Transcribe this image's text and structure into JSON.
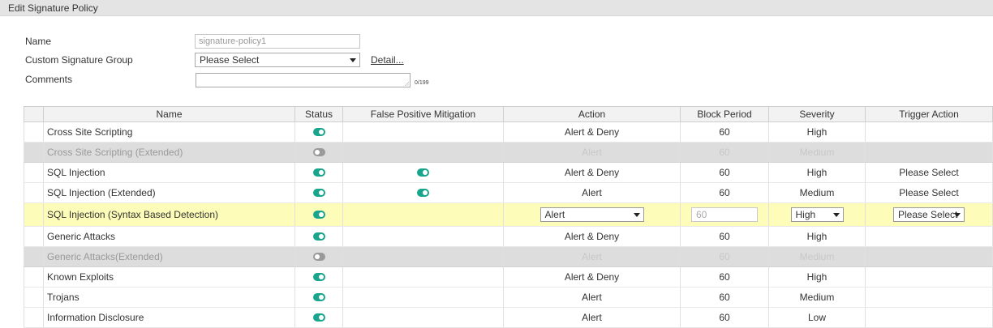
{
  "window": {
    "title": "Edit Signature Policy"
  },
  "form": {
    "name_label": "Name",
    "name_value": "signature-policy1",
    "group_label": "Custom Signature Group",
    "group_value": "Please Select",
    "detail_link": "Detail...",
    "comments_label": "Comments",
    "comments_value": "",
    "comments_counter": "0/199"
  },
  "table": {
    "headers": [
      "Name",
      "Status",
      "False Positive Mitigation",
      "Action",
      "Block Period",
      "Severity",
      "Trigger Action"
    ],
    "rows": [
      {
        "name": "Cross Site Scripting",
        "status": true,
        "fpm": null,
        "action": "Alert & Deny",
        "block_period": "60",
        "severity": "High",
        "trigger": ""
      },
      {
        "name": "Cross Site Scripting (Extended)",
        "status": false,
        "fpm": null,
        "action": "Alert",
        "block_period": "60",
        "severity": "Medium",
        "trigger": ""
      },
      {
        "name": "SQL Injection",
        "status": true,
        "fpm": true,
        "action": "Alert & Deny",
        "block_period": "60",
        "severity": "High",
        "trigger": "Please Select"
      },
      {
        "name": "SQL Injection (Extended)",
        "status": true,
        "fpm": true,
        "action": "Alert",
        "block_period": "60",
        "severity": "Medium",
        "trigger": "Please Select"
      },
      {
        "name": "SQL Injection (Syntax Based Detection)",
        "status": true,
        "fpm": null,
        "action": "Alert",
        "block_period": "60",
        "severity": "High",
        "trigger": "Please Select",
        "editing": true
      },
      {
        "name": "Generic Attacks",
        "status": true,
        "fpm": null,
        "action": "Alert & Deny",
        "block_period": "60",
        "severity": "High",
        "trigger": ""
      },
      {
        "name": "Generic Attacks(Extended)",
        "status": false,
        "fpm": null,
        "action": "Alert",
        "block_period": "60",
        "severity": "Medium",
        "trigger": ""
      },
      {
        "name": "Known Exploits",
        "status": true,
        "fpm": null,
        "action": "Alert & Deny",
        "block_period": "60",
        "severity": "High",
        "trigger": ""
      },
      {
        "name": "Trojans",
        "status": true,
        "fpm": null,
        "action": "Alert",
        "block_period": "60",
        "severity": "Medium",
        "trigger": ""
      },
      {
        "name": "Information Disclosure",
        "status": true,
        "fpm": null,
        "action": "Alert",
        "block_period": "60",
        "severity": "Low",
        "trigger": ""
      }
    ]
  },
  "colors": {
    "toggle_on": "#18a58c",
    "toggle_off": "#9a9a9a",
    "highlight_row": "#fdfdb9",
    "disabled_row": "#dddddd"
  }
}
